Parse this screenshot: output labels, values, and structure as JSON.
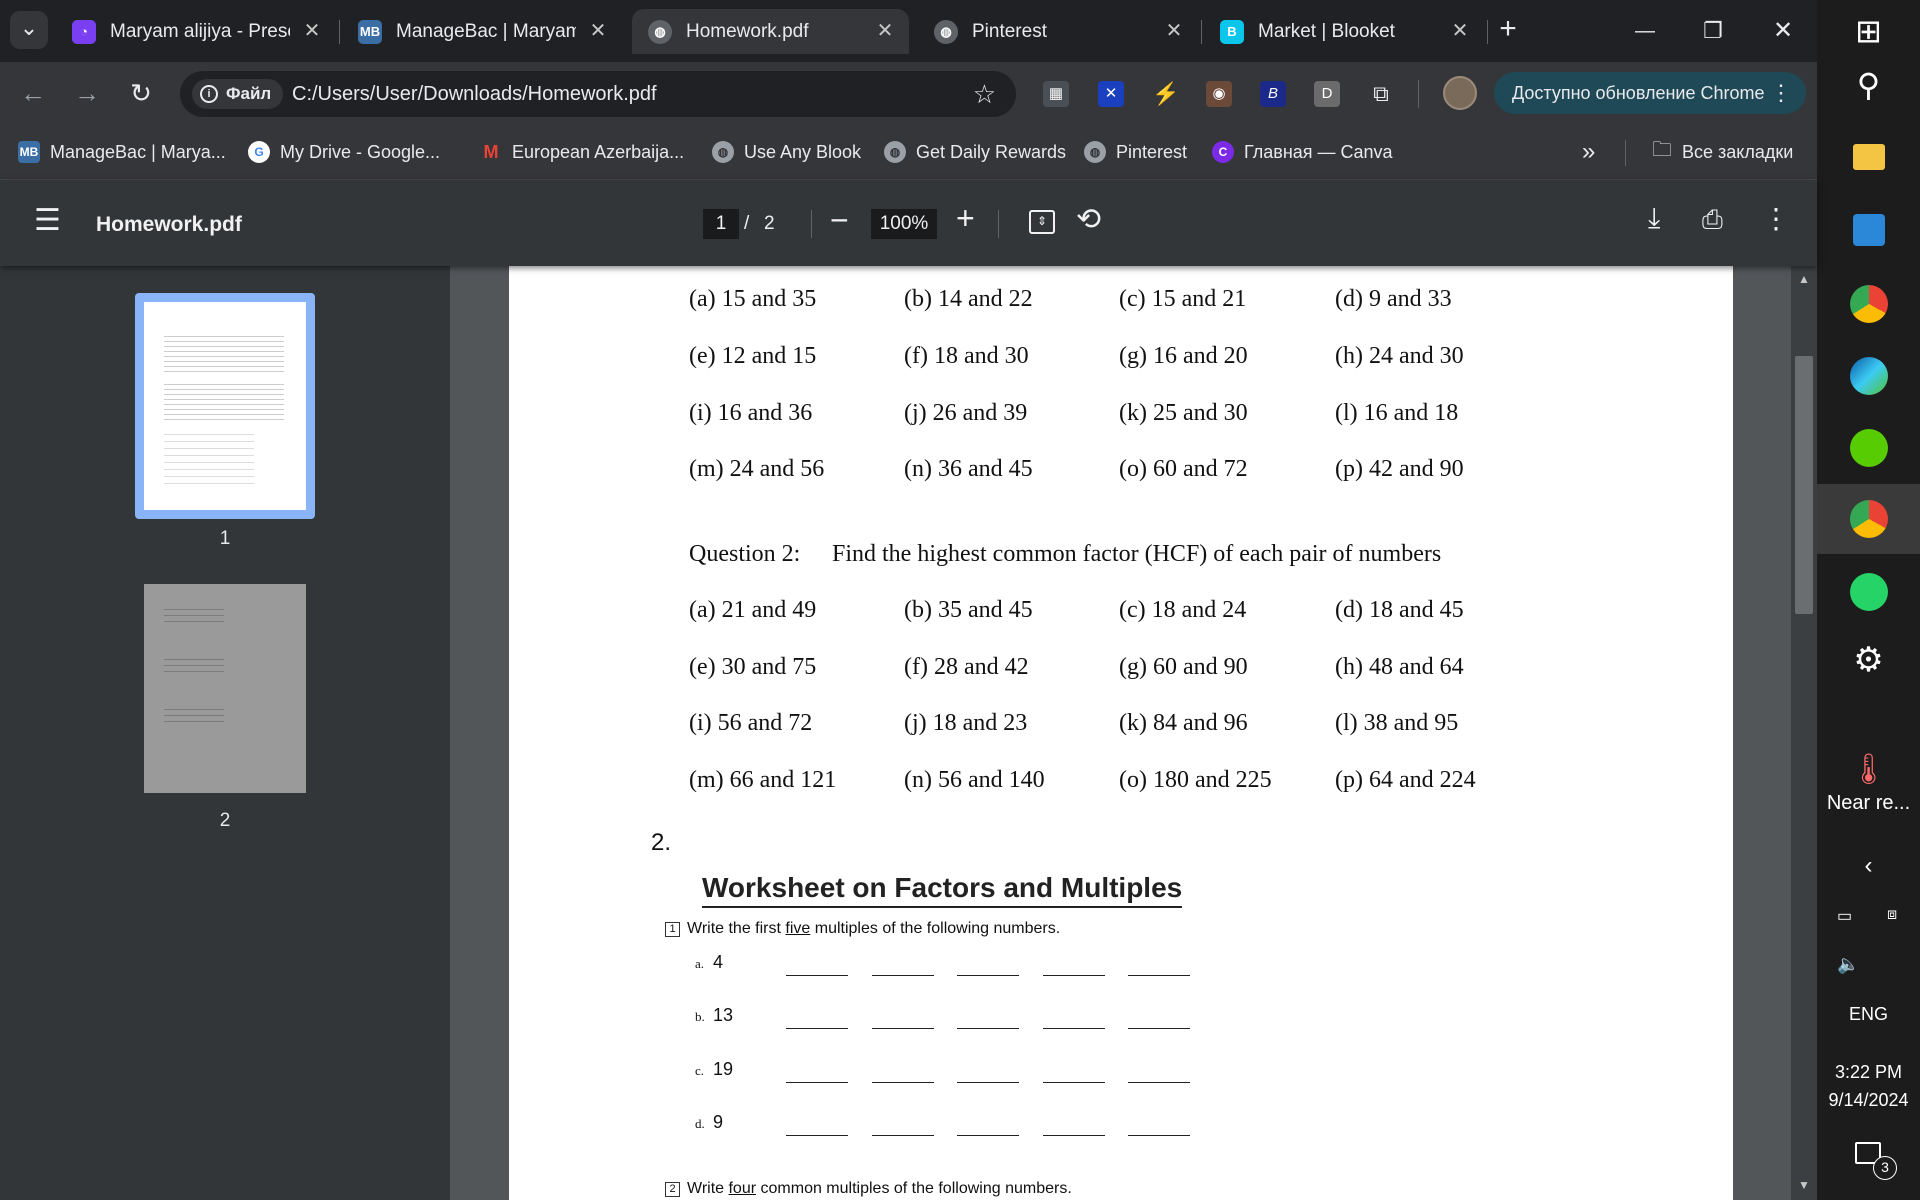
{
  "tabs": [
    {
      "title": "Maryam alijiya - Presen",
      "icon": "presentation-icon",
      "color": "#7b3ff2"
    },
    {
      "title": "ManageBac | Maryam I",
      "icon": "managebac-icon",
      "color": "#3a6ea5"
    },
    {
      "title": "Homework.pdf",
      "icon": "globe-icon",
      "active": true
    },
    {
      "title": "Pinterest",
      "icon": "globe-icon"
    },
    {
      "title": "Market | Blooket",
      "icon": "blooket-icon",
      "color": "#0bc5ea"
    }
  ],
  "tab_glyphs": {
    "close": "✕",
    "new_tab": "+",
    "menu": "⌄"
  },
  "window": {
    "minimize": "—",
    "restore": "❐",
    "close": "✕"
  },
  "omnibox": {
    "site_chip": "Файл",
    "url": "C:/Users/User/Downloads/Homework.pdf"
  },
  "toolbar": {
    "update_label": "Доступно обновление Chrome"
  },
  "extensions": [
    {
      "name": "calculator-ext-icon",
      "glyph": "▦",
      "color": "#4a4f55"
    },
    {
      "name": "x-ext-icon",
      "glyph": "✕",
      "color": "#1a3fbf"
    },
    {
      "name": "bolt-ext-icon",
      "glyph": "⚡",
      "color": "transparent"
    },
    {
      "name": "avatar-ext-icon",
      "glyph": "◉",
      "color": "#6b4a3a"
    },
    {
      "name": "b-ext-icon",
      "glyph": "B",
      "color": "#1b2a8a"
    },
    {
      "name": "d-ext-icon",
      "glyph": "D",
      "color": "#6b6b6b"
    },
    {
      "name": "puzzle-ext-icon",
      "glyph": "⧉",
      "color": "transparent"
    }
  ],
  "bookmarks": [
    {
      "label": "ManageBac | Marya...",
      "icon": "managebac-icon",
      "color": "#3a6ea5",
      "glyph": "M"
    },
    {
      "label": "My Drive - Google...",
      "icon": "google-icon",
      "color": "#4285f4",
      "glyph": "G"
    },
    {
      "label": "European Azerbaija...",
      "icon": "gmail-icon",
      "color": "#ea4335",
      "glyph": "M"
    },
    {
      "label": "Use Any Blook",
      "icon": "globe-icon",
      "color": "#5f6368",
      "glyph": "◍"
    },
    {
      "label": "Get Daily Rewards",
      "icon": "globe-icon",
      "color": "#5f6368",
      "glyph": "◍"
    },
    {
      "label": "Pinterest",
      "icon": "globe-icon",
      "color": "#5f6368",
      "glyph": "◍"
    },
    {
      "label": "Главная — Canva",
      "icon": "canva-icon",
      "color": "#7d2ae8",
      "glyph": "C"
    }
  ],
  "bookmarks_more": "»",
  "all_bookmarks": "Все закладки",
  "pdf": {
    "title": "Homework.pdf",
    "page_current": "1",
    "page_sep": "/",
    "page_total": "2",
    "zoom": "100%",
    "thumb_labels": [
      "1",
      "2"
    ]
  },
  "q1_rows": [
    [
      "(a)  15 and 35",
      "(b)  14 and 22",
      "(c)  15 and 21",
      "(d)  9 and 33"
    ],
    [
      "(e)  12 and 15",
      "(f)   18 and 30",
      "(g)  16 and 20",
      "(h)  24 and 30"
    ],
    [
      "(i)   16 and 36",
      "(j)    26 and 39",
      "(k)  25 and 30",
      "(l)   16 and 18"
    ],
    [
      "(m)  24 and 56",
      "(n)   36 and 45",
      "(o)  60 and 72",
      "(p)  42 and 90"
    ]
  ],
  "q2": {
    "label": "Question 2:",
    "text": "Find the highest common factor (HCF) of each pair of numbers",
    "rows": [
      [
        "(a)  21 and 49",
        "(b)  35 and 45",
        "(c)  18 and 24",
        "(d)  18 and 45"
      ],
      [
        "(e)  30 and 75",
        "(f)  28 and 42",
        "(g)  60 and 90",
        "(h)  48 and 64"
      ],
      [
        "(i)   56 and 72",
        "(j)  18 and 23",
        "(k)  84 and 96",
        "(l)   38 and 95"
      ],
      [
        "(m)  66 and 121",
        "(n)  56 and 140",
        "(o)  180 and 225",
        "(p)  64 and 224"
      ]
    ]
  },
  "worksheet": {
    "section_number": "2.",
    "title": "Worksheet on Factors and Multiples",
    "item1_num": "1",
    "item1_pre": "Write the first ",
    "item1_u": "five",
    "item1_post": " multiples of the following numbers.",
    "rows": [
      {
        "letter": "a.",
        "value": "4"
      },
      {
        "letter": "b.",
        "value": "13"
      },
      {
        "letter": "c.",
        "value": "19"
      },
      {
        "letter": "d.",
        "value": "9"
      }
    ],
    "item2_num": "2",
    "item2_pre": "Write ",
    "item2_u": "four",
    "item2_post": " common multiples of the following numbers."
  },
  "taskbar": {
    "weather": "Near re...",
    "lang": "ENG",
    "time": "3:22 PM",
    "date": "9/14/2024",
    "notif_count": "3"
  }
}
